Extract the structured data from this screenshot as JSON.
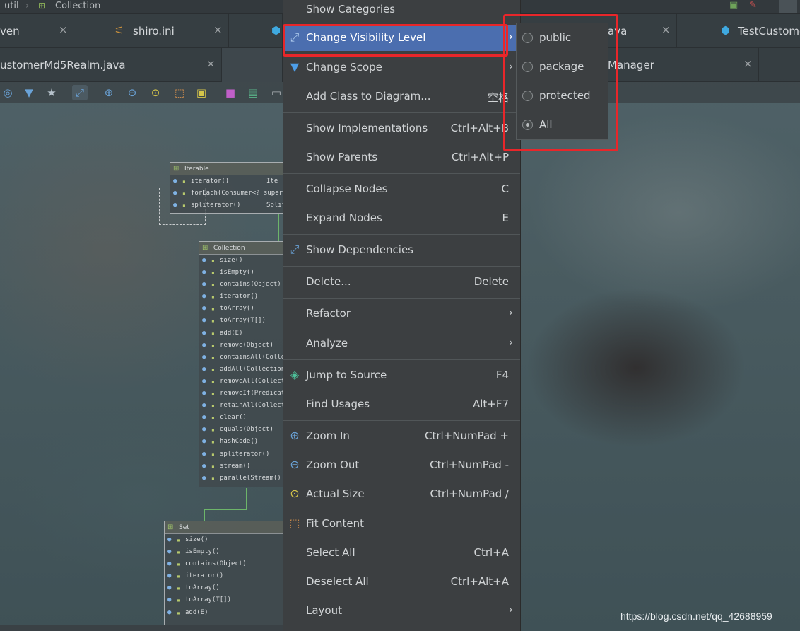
{
  "breadcrumb": {
    "items": [
      "util",
      "Collection"
    ],
    "separator": "›"
  },
  "tabs_row1": [
    {
      "label": "ven",
      "icon": "maven-icon"
    },
    {
      "label": "shiro.ini",
      "icon": "settings-file-icon"
    },
    {
      "label": "",
      "icon": "java-class-icon"
    },
    {
      "label": "ava",
      "icon": ""
    },
    {
      "label": "TestCustome",
      "icon": "java-class-icon"
    }
  ],
  "tabs_row2": [
    {
      "label": "ustomerMd5Realm.java"
    },
    {
      "label": ""
    },
    {
      "label": "Manager"
    }
  ],
  "close_glyph": "×",
  "toolbar_icons": [
    "show-categories-icon",
    "filter-icon",
    "show-members-icon",
    "visibility-icon",
    "zoom-in-icon",
    "zoom-out-icon",
    "actual-size-icon",
    "fit-content-icon",
    "layout-icon",
    "save-icon",
    "export-icon",
    "print-icon"
  ],
  "uml": {
    "iterable": {
      "title": "Iterable",
      "rows": [
        {
          "name": "iterator()",
          "type": "Ite"
        },
        {
          "name": "forEach(Consumer<? super T",
          "type": ""
        },
        {
          "name": "spliterator()",
          "type": "Splite"
        }
      ]
    },
    "collection": {
      "title": "Collection",
      "rows": [
        "size()",
        "isEmpty()",
        "contains(Object)",
        "iterator()",
        "toArray()",
        "toArray(T[])",
        "add(E)",
        "remove(Object)",
        "containsAll(Collection",
        "addAll(Collection<?",
        "removeAll(Collection",
        "removeIf(Predicate<",
        "retainAll(Collection<",
        "clear()",
        "equals(Object)",
        "hashCode()",
        "spliterator()",
        "stream()",
        "parallelStream()"
      ]
    },
    "set": {
      "title": "Set",
      "rows": [
        "size()",
        "isEmpty()",
        "contains(Object)",
        "iterator()",
        "toArray()",
        "toArray(T[])",
        "add(E)"
      ]
    }
  },
  "context_menu": {
    "items": {
      "show_categories": {
        "label": "Show Categories"
      },
      "change_visibility": {
        "label": "Change Visibility Level",
        "icon": "visibility-icon"
      },
      "change_scope": {
        "label": "Change Scope",
        "icon": "filter-icon"
      },
      "add_class": {
        "label": "Add Class to Diagram...",
        "shortcut": "空格"
      },
      "show_impl": {
        "label": "Show Implementations",
        "shortcut": "Ctrl+Alt+B"
      },
      "show_parents": {
        "label": "Show Parents",
        "shortcut": "Ctrl+Alt+P"
      },
      "collapse": {
        "label": "Collapse Nodes",
        "shortcut": "C"
      },
      "expand": {
        "label": "Expand Nodes",
        "shortcut": "E"
      },
      "show_deps": {
        "label": "Show Dependencies",
        "icon": "dependencies-icon"
      },
      "delete": {
        "label": "Delete...",
        "shortcut": "Delete"
      },
      "refactor": {
        "label": "Refactor"
      },
      "analyze": {
        "label": "Analyze"
      },
      "jump": {
        "label": "Jump to Source",
        "shortcut": "F4",
        "icon": "jump-to-source-icon"
      },
      "find_usages": {
        "label": "Find Usages",
        "shortcut": "Alt+F7"
      },
      "zoom_in": {
        "label": "Zoom In",
        "shortcut": "Ctrl+NumPad +",
        "icon": "zoom-in-icon"
      },
      "zoom_out": {
        "label": "Zoom Out",
        "shortcut": "Ctrl+NumPad -",
        "icon": "zoom-out-icon"
      },
      "actual_size": {
        "label": "Actual Size",
        "shortcut": "Ctrl+NumPad /",
        "icon": "actual-size-icon"
      },
      "fit_content": {
        "label": "Fit Content",
        "icon": "fit-content-icon"
      },
      "select_all": {
        "label": "Select All",
        "shortcut": "Ctrl+A"
      },
      "deselect_all": {
        "label": "Deselect All",
        "shortcut": "Ctrl+Alt+A"
      },
      "layout": {
        "label": "Layout"
      }
    },
    "submenu_arrow": "›"
  },
  "visibility_submenu": {
    "options": [
      "public",
      "package",
      "protected",
      "All"
    ],
    "selected": "All"
  },
  "colors": {
    "menu_bg": "#3c3f41",
    "menu_selected": "#4b6eaf",
    "highlight_box": "#e8262a"
  },
  "watermark": "https://blog.csdn.net/qq_42688959"
}
